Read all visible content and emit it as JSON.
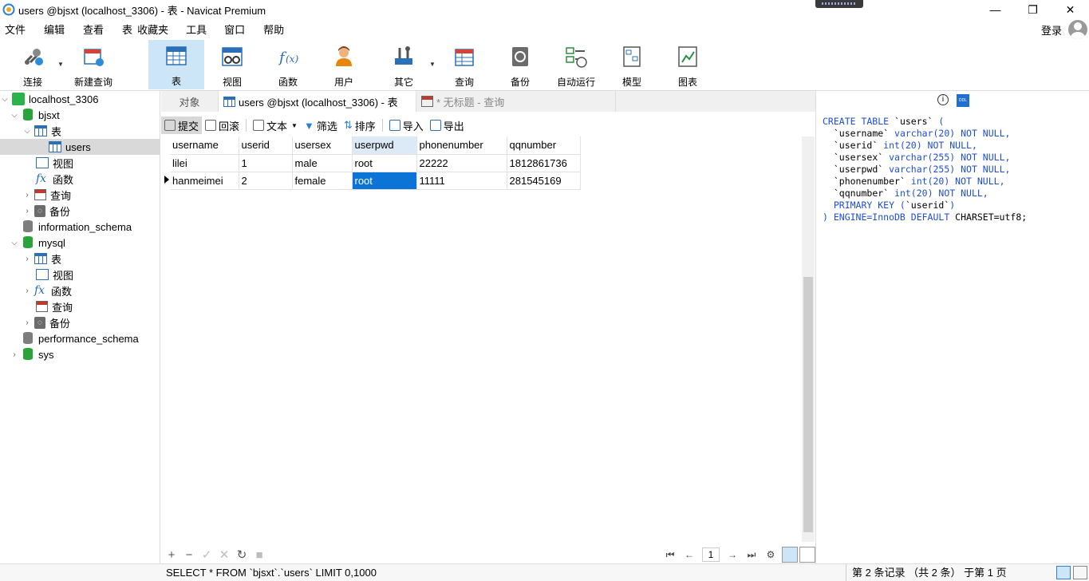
{
  "window": {
    "title": "users @bjsxt (localhost_3306) - 表 - Navicat Premium",
    "minimize": "—",
    "restore": "❐",
    "close": "✕"
  },
  "menu": {
    "items": [
      "文件",
      "编辑",
      "查看",
      "表",
      "收藏夹",
      "工具",
      "窗口",
      "帮助"
    ],
    "login": "登录"
  },
  "toolbar": {
    "buttons": [
      {
        "label": "连接",
        "icon": "plug-icon"
      },
      {
        "label": "新建查询",
        "icon": "new-query-icon"
      },
      {
        "label": "表",
        "icon": "table-icon"
      },
      {
        "label": "视图",
        "icon": "view-icon"
      },
      {
        "label": "函数",
        "icon": "function-icon"
      },
      {
        "label": "用户",
        "icon": "user-icon"
      },
      {
        "label": "其它",
        "icon": "tools-icon"
      },
      {
        "label": "查询",
        "icon": "query-icon"
      },
      {
        "label": "备份",
        "icon": "backup-icon"
      },
      {
        "label": "自动运行",
        "icon": "schedule-icon"
      },
      {
        "label": "模型",
        "icon": "model-icon"
      },
      {
        "label": "图表",
        "icon": "chart-icon"
      }
    ],
    "active": "表"
  },
  "tree": {
    "items": [
      {
        "label": "localhost_3306",
        "type": "connection",
        "expanded": true
      },
      {
        "label": "bjsxt",
        "type": "database",
        "expanded": true
      },
      {
        "label": "表",
        "type": "tables",
        "expanded": true
      },
      {
        "label": "users",
        "type": "table",
        "selected": true
      },
      {
        "label": "视图",
        "type": "views"
      },
      {
        "label": "函数",
        "type": "functions"
      },
      {
        "label": "查询",
        "type": "queries"
      },
      {
        "label": "备份",
        "type": "backups"
      },
      {
        "label": "information_schema",
        "type": "database-gray"
      },
      {
        "label": "mysql",
        "type": "database",
        "expanded": true
      },
      {
        "label": "表",
        "type": "tables"
      },
      {
        "label": "视图",
        "type": "views"
      },
      {
        "label": "函数",
        "type": "functions"
      },
      {
        "label": "查询",
        "type": "queries"
      },
      {
        "label": "备份",
        "type": "backups"
      },
      {
        "label": "performance_schema",
        "type": "database-gray"
      },
      {
        "label": "sys",
        "type": "database"
      }
    ]
  },
  "tabs": {
    "objects": "对象",
    "active": "users @bjsxt (localhost_3306) - 表",
    "inactive": "* 无标题 - 查询"
  },
  "subtoolbar": {
    "commit": "提交",
    "rollback": "回滚",
    "text": "文本",
    "filter": "筛选",
    "sort": "排序",
    "import": "导入",
    "export": "导出"
  },
  "grid": {
    "columns": [
      "username",
      "userid",
      "usersex",
      "userpwd",
      "phonenumber",
      "qqnumber"
    ],
    "rows": [
      [
        "lilei",
        "1",
        "male",
        "root",
        "22222",
        "1812861736"
      ],
      [
        "hanmeimei",
        "2",
        "female",
        "root",
        "11111",
        "281545169"
      ]
    ],
    "selected_row": 1,
    "selected_col": 3
  },
  "pager": {
    "page": "1"
  },
  "ddl": {
    "lines": [
      "CREATE TABLE `users` (",
      "  `username` varchar(20) NOT NULL,",
      "  `userid` int(20) NOT NULL,",
      "  `usersex` varchar(255) NOT NULL,",
      "  `userpwd` varchar(255) NOT NULL,",
      "  `phonenumber` int(20) NOT NULL,",
      "  `qqnumber` int(20) NOT NULL,",
      "  PRIMARY KEY (`userid`)",
      ") ENGINE=InnoDB DEFAULT CHARSET=utf8;"
    ],
    "ddl_badge": "DDL"
  },
  "status": {
    "sql": "SELECT * FROM `bjsxt`.`users` LIMIT 0,1000",
    "record": "第 2 条记录 （共 2 条） 于第 1 页"
  }
}
